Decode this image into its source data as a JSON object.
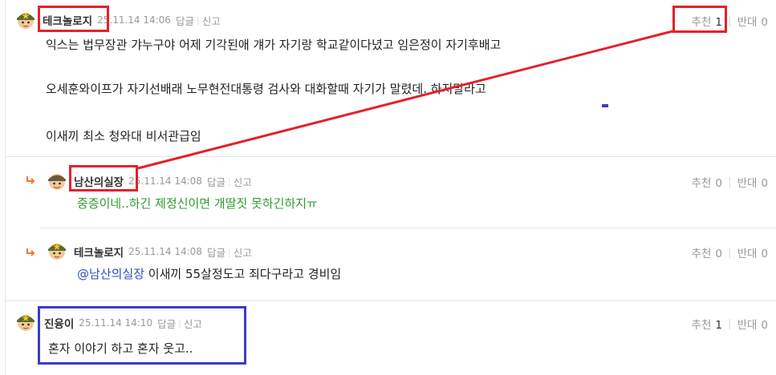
{
  "comments": [
    {
      "nickname": "테크놀로지",
      "date": "25.11.14 14:06",
      "reply_label": "답글",
      "report_label": "신고",
      "recommend_label": "추천",
      "recommend_count": "1",
      "oppose_label": "반대",
      "oppose_count": "0",
      "lines": [
        "익스는 법무장관 갸누구야 어제 기각된애 걔가 자기랑 학교같이다녔고 임은정이 자기후배고",
        "오세훈와이프가 자기선배래 노무현전대통령 검사와 대화할때 자기가 말렸데. 하지말라고",
        "이새끼 최소 청와대 비서관급임"
      ]
    },
    {
      "nickname": "남산의실장",
      "date": "25.11.14 14:08",
      "reply_label": "답글",
      "report_label": "신고",
      "recommend_label": "추천",
      "recommend_count": "0",
      "oppose_label": "반대",
      "oppose_count": "0",
      "text": "중증이네..하긴 제정신이면 개딸짓 못하긴하지ㅠ"
    },
    {
      "nickname": "테크놀로지",
      "date": "25.11.14 14:08",
      "reply_label": "답글",
      "report_label": "신고",
      "recommend_label": "추천",
      "recommend_count": "0",
      "oppose_label": "반대",
      "oppose_count": "0",
      "mention": "@남산의실장",
      "text": " 이새끼 55살정도고 죄다구라고 경비임"
    },
    {
      "nickname": "진융이",
      "date": "25.11.14 14:10",
      "reply_label": "답글",
      "report_label": "신고",
      "recommend_label": "추천",
      "recommend_count": "1",
      "oppose_label": "반대",
      "oppose_count": "0",
      "text": "혼자 이야기 하고 혼자 웃고.."
    }
  ],
  "colors": {
    "annotation_red": "#e5202a",
    "annotation_blue": "#3a3cc8",
    "reply_green": "#2f9a2f",
    "mention_blue": "#2a4fc7",
    "reply_arrow": "#f07a2b"
  },
  "icons": {
    "avatar": "soldier-avatar-icon",
    "reply_arrow": "reply-arrow-icon"
  }
}
